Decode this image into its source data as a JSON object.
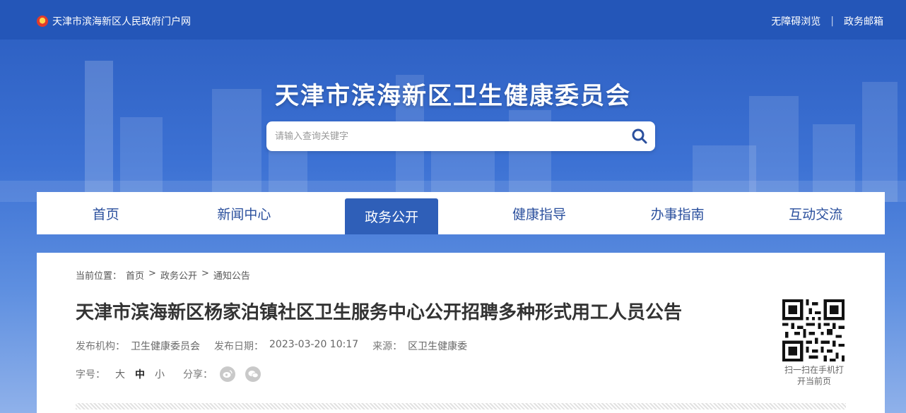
{
  "topbar": {
    "portal_label": "天津市滨海新区人民政府门户网",
    "accessibility_label": "无障碍浏览",
    "mail_label": "政务邮箱"
  },
  "header": {
    "site_title": "天津市滨海新区卫生健康委员会",
    "search_placeholder": "请输入查询关键字"
  },
  "nav": {
    "items": [
      {
        "label": "首页"
      },
      {
        "label": "新闻中心"
      },
      {
        "label": "政务公开",
        "active": true
      },
      {
        "label": "健康指导"
      },
      {
        "label": "办事指南"
      },
      {
        "label": "互动交流"
      }
    ]
  },
  "breadcrumb": {
    "prefix": "当前位置：",
    "items": [
      "首页",
      "政务公开",
      "通知公告"
    ],
    "separator": ">"
  },
  "article": {
    "title": "天津市滨海新区杨家泊镇社区卫生服务中心公开招聘多种形式用工人员公告",
    "publisher_label": "发布机构：",
    "publisher": "卫生健康委员会",
    "date_label": "发布日期：",
    "date": "2023-03-20 10:17",
    "source_label": "来源：",
    "source": "区卫生健康委"
  },
  "tools": {
    "font_label": "字号：",
    "sizes": [
      "大",
      "中",
      "小"
    ],
    "current_size": "中",
    "share_label": "分享："
  },
  "qr": {
    "caption_line1": "扫一扫在手机打",
    "caption_line2": "开当前页"
  },
  "colors": {
    "brand_blue": "#2f5fb8",
    "topbar_blue": "#2456b8",
    "nav_text": "#2a4f9d"
  }
}
